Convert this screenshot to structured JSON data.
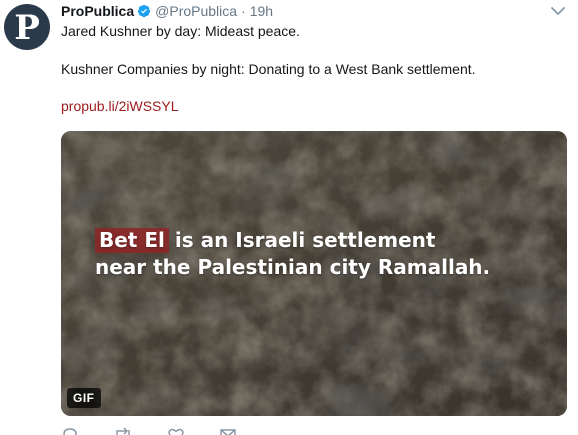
{
  "tweet": {
    "avatar_letter": "P",
    "display_name": "ProPublica",
    "handle": "@ProPublica",
    "separator": "·",
    "time": "19h",
    "verified": true,
    "line1": "Jared Kushner by day: Mideast peace.",
    "line2": "Kushner Companies by night: Donating to a West Bank settlement.",
    "link": "propub.li/2iWSSYL"
  },
  "media": {
    "caption_highlight": "Bet El",
    "caption_line1_rest": "is an Israeli settlement",
    "caption_line2": "near the Palestinian city Ramallah.",
    "badge": "GIF"
  },
  "colors": {
    "link": "#9b1b1b",
    "verified": "#1da1f2",
    "avatar_bg": "#2b3a4a",
    "highlight": "#912323"
  },
  "icons": [
    "verified-icon",
    "caret-down-icon",
    "reply-icon",
    "retweet-icon",
    "like-icon",
    "message-icon"
  ]
}
